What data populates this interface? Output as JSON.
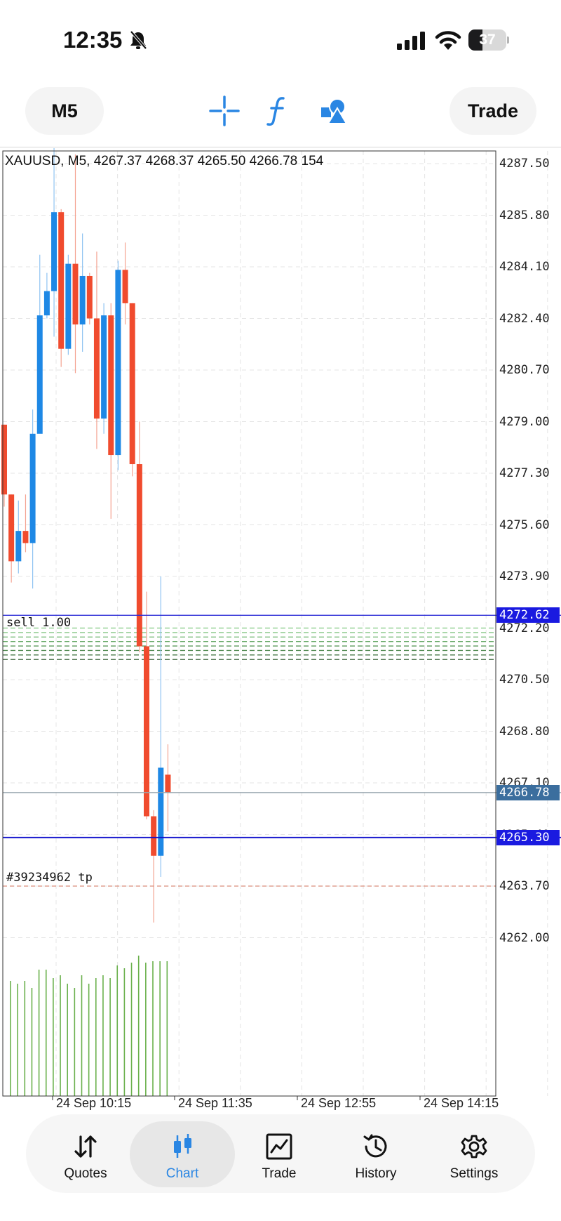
{
  "status_bar": {
    "time": "12:35",
    "battery": "37"
  },
  "toolbar": {
    "timeframe": "M5",
    "trade_label": "Trade",
    "icons": [
      "crosshair-icon",
      "indicator-f-icon",
      "objects-shapes-icon"
    ]
  },
  "chart": {
    "title": "XAUUSD, M5, 4267.37 4268.37 4265.50 4266.78 154",
    "price_labels": [
      "4287.50",
      "4285.80",
      "4284.10",
      "4282.40",
      "4280.70",
      "4279.00",
      "4277.30",
      "4275.60",
      "4273.90",
      "4272.20",
      "4270.50",
      "4268.80",
      "4267.10",
      "4265.40",
      "4263.70",
      "4262.00"
    ],
    "price_tags": {
      "ask": "4272.62",
      "last": "4266.78",
      "bid": "4265.30"
    },
    "time_labels": [
      "24 Sep 10:15",
      "24 Sep 11:35",
      "24 Sep 12:55",
      "24 Sep 14:15"
    ],
    "order_label": "sell 1.00",
    "tp_label": "#39234962 tp",
    "colors": {
      "bull": "#1e88e5",
      "bear": "#f04b2e",
      "volume": "#6ab04c",
      "ask_line": "#2b2bd6",
      "bid_line": "#1010cc",
      "last_line": "#9aa7b0",
      "order_line": "#2e8b2e",
      "tp_line": "#e0a090",
      "last_tag": "#3b6e9e",
      "ask_tag": "#1a1ae0"
    }
  },
  "chart_data": {
    "type": "candlestick",
    "title": "XAUUSD, M5, 4267.37 4268.37 4265.50 4266.78 154",
    "symbol": "XAUUSD",
    "timeframe": "M5",
    "last_bar": {
      "open": 4267.37,
      "high": 4268.37,
      "low": 4265.5,
      "close": 4266.78,
      "volume": 154
    },
    "y_tick_labels": [
      "4287.50",
      "4285.80",
      "4284.10",
      "4282.40",
      "4280.70",
      "4279.00",
      "4277.30",
      "4275.60",
      "4273.90",
      "4272.20",
      "4270.50",
      "4268.80",
      "4267.10",
      "4265.40",
      "4263.70",
      "4262.00"
    ],
    "x_tick_labels": [
      "24 Sep 10:15",
      "24 Sep 11:35",
      "24 Sep 12:55",
      "24 Sep 14:15"
    ],
    "ylim": [
      4257.5,
      4288.8
    ],
    "grid": true,
    "candles": [
      {
        "o": 4278.9,
        "h": 4278.9,
        "l": 4276.2,
        "c": 4276.6
      },
      {
        "o": 4276.6,
        "h": 4276.6,
        "l": 4273.7,
        "c": 4274.4
      },
      {
        "o": 4274.4,
        "h": 4276.4,
        "l": 4274.0,
        "c": 4275.4
      },
      {
        "o": 4275.4,
        "h": 4276.6,
        "l": 4274.7,
        "c": 4275.0
      },
      {
        "o": 4275.0,
        "h": 4279.4,
        "l": 4273.5,
        "c": 4278.6
      },
      {
        "o": 4278.6,
        "h": 4284.5,
        "l": 4278.8,
        "c": 4282.5
      },
      {
        "o": 4282.5,
        "h": 4283.9,
        "l": 4282.4,
        "c": 4283.3
      },
      {
        "o": 4283.3,
        "h": 4288.2,
        "l": 4281.8,
        "c": 4285.9
      },
      {
        "o": 4285.9,
        "h": 4286.0,
        "l": 4280.8,
        "c": 4281.4
      },
      {
        "o": 4281.4,
        "h": 4284.5,
        "l": 4281.2,
        "c": 4284.2
      },
      {
        "o": 4284.2,
        "h": 4287.8,
        "l": 4280.6,
        "c": 4282.2
      },
      {
        "o": 4282.2,
        "h": 4285.2,
        "l": 4281.3,
        "c": 4283.8
      },
      {
        "o": 4283.8,
        "h": 4283.9,
        "l": 4282.2,
        "c": 4282.4
      },
      {
        "o": 4282.4,
        "h": 4284.6,
        "l": 4278.1,
        "c": 4279.1
      },
      {
        "o": 4279.1,
        "h": 4282.9,
        "l": 4278.6,
        "c": 4282.5
      },
      {
        "o": 4282.5,
        "h": 4282.9,
        "l": 4275.8,
        "c": 4277.9
      },
      {
        "o": 4277.9,
        "h": 4284.3,
        "l": 4277.4,
        "c": 4284.0
      },
      {
        "o": 4284.0,
        "h": 4284.9,
        "l": 4282.2,
        "c": 4282.9
      },
      {
        "o": 4282.9,
        "h": 4282.9,
        "l": 4277.2,
        "c": 4277.6
      },
      {
        "o": 4277.6,
        "h": 4279.0,
        "l": 4271.4,
        "c": 4271.6
      },
      {
        "o": 4271.6,
        "h": 4273.4,
        "l": 4265.9,
        "c": 4266.0
      },
      {
        "o": 4266.0,
        "h": 4266.2,
        "l": 4262.5,
        "c": 4264.7
      },
      {
        "o": 4264.7,
        "h": 4273.9,
        "l": 4264.0,
        "c": 4267.6
      },
      {
        "o": 4267.37,
        "h": 4268.37,
        "l": 4265.5,
        "c": 4266.78
      }
    ],
    "volume": [
      0.82,
      0.8,
      0.82,
      0.77,
      0.9,
      0.9,
      0.84,
      0.86,
      0.8,
      0.77,
      0.86,
      0.8,
      0.84,
      0.86,
      0.84,
      0.93,
      0.91,
      0.95,
      1.0,
      0.95,
      0.96,
      0.96,
      0.96
    ],
    "lines": [
      {
        "name": "ask",
        "price": 4272.62
      },
      {
        "name": "last",
        "price": 4266.78
      },
      {
        "name": "bid",
        "price": 4265.3
      },
      {
        "name": "tp",
        "price": 4263.7
      }
    ],
    "order_levels": [
      4272.2,
      4272.08,
      4271.96,
      4271.84,
      4271.72,
      4271.6,
      4271.48,
      4271.36
    ]
  },
  "bottom_nav": {
    "items": [
      {
        "label": "Quotes",
        "icon": "quotes-arrows-icon"
      },
      {
        "label": "Chart",
        "icon": "candlestick-icon",
        "active": true
      },
      {
        "label": "Trade",
        "icon": "trade-chart-icon"
      },
      {
        "label": "History",
        "icon": "history-clock-icon"
      },
      {
        "label": "Settings",
        "icon": "gear-icon"
      }
    ]
  }
}
